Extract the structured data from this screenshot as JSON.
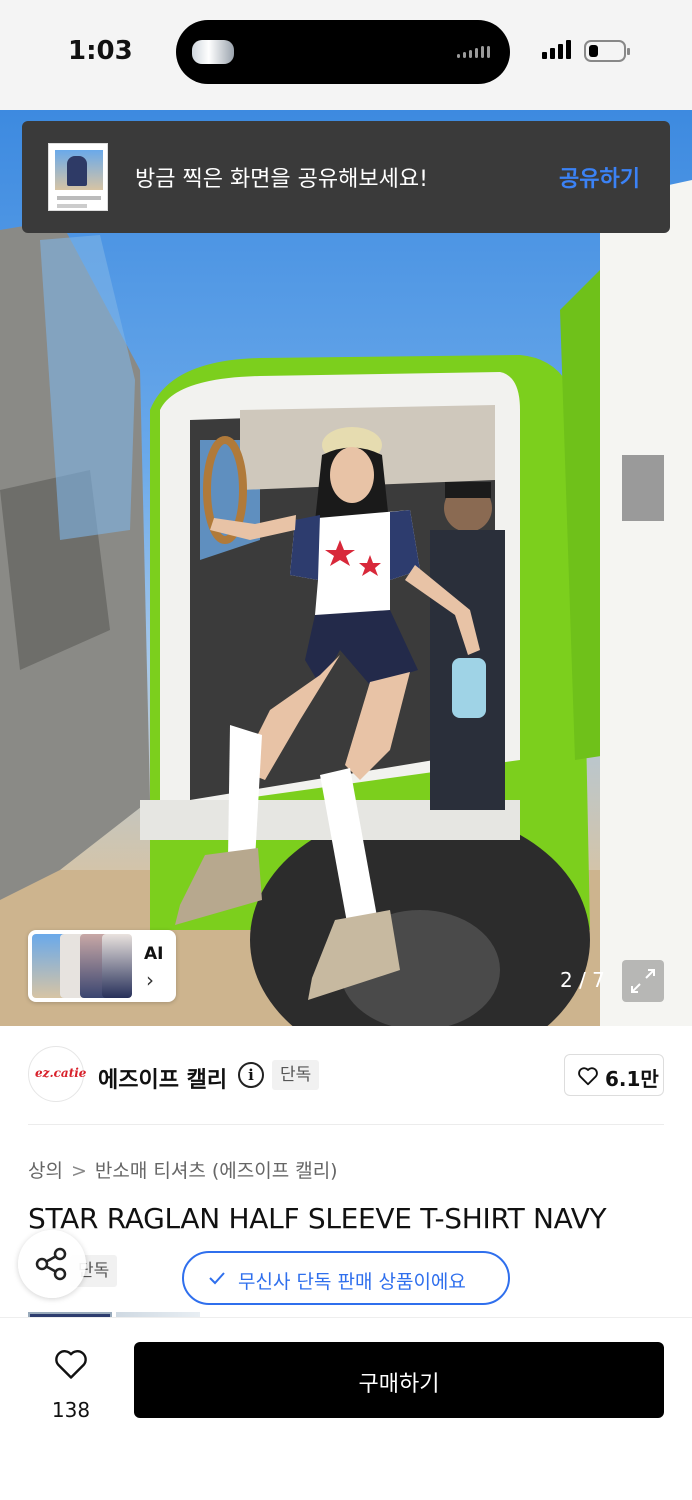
{
  "status_bar": {
    "time": "1:03"
  },
  "toast": {
    "message": "방금 찍은 화면을 공유해보세요!",
    "action": "공유하기"
  },
  "hero": {
    "page_counter": "2 / 7",
    "ai_label": "AI",
    "ai_chevron": "›"
  },
  "brand": {
    "logo_text": "ez.catie",
    "name": "에즈이프 캘리",
    "info_glyph": "i",
    "badge": "단독",
    "likes": "6.1만"
  },
  "breadcrumb": {
    "level1": "상의",
    "separator": ">",
    "level2": "반소매 티셔츠 (에즈이프 캘리)"
  },
  "product": {
    "title": "STAR RAGLAN HALF SLEEVE T-SHIRT NAVY",
    "exclusive_tag": "단독",
    "exclusive_notice": "무신사 단독 판매 상품이에요"
  },
  "bottom_bar": {
    "wish_count": "138",
    "buy_label": "구매하기"
  },
  "colors": {
    "accent_blue": "#2f6fed",
    "toast_bg": "#3a3a3a",
    "buy_bg": "#000000",
    "truck_green": "#7ccf1d"
  }
}
